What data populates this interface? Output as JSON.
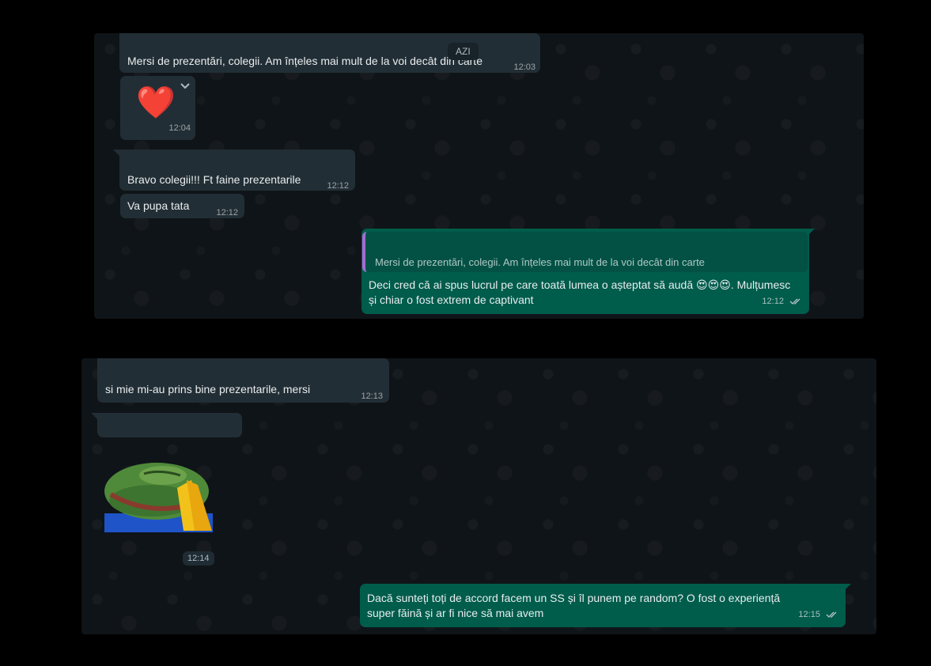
{
  "chat1": {
    "date_chip": "AZI",
    "messages": [
      {
        "text": "Mersi de prezentări, colegii. Am înțeles mai mult de la voi decât din carte",
        "time": "12:03"
      },
      {
        "emoji": "❤️",
        "time": "12:04"
      },
      {
        "text": "Bravo colegii!!! Ft faine prezentarile",
        "time": "12:12"
      },
      {
        "text": "Va pupa tata",
        "time": "12:12"
      }
    ],
    "reply": {
      "quoted": "Mersi de prezentări, colegii. Am înțeles mai mult de la voi decât din carte",
      "line1": "Deci cred că ai spus lucrul pe care toată lumea o așteptat să audă 😍😍😍. Mulțumesc",
      "line2": "și chiar o fost extrem de captivant",
      "time": "12:12"
    }
  },
  "chat2": {
    "messages": [
      {
        "text": "si mie mi-au prins bine prezentarile, mersi",
        "time": "12:13"
      },
      {
        "text": "",
        "time": ""
      },
      {
        "sticker": "pepe-praying-sticker",
        "time": "12:14"
      }
    ],
    "reply": {
      "line1": "Dacă sunteți toți de accord facem un SS și îl punem pe random? O fost o experiență",
      "line2": "super făină și ar fi nice să mai avem",
      "time": "12:15"
    }
  },
  "colors": {
    "incoming": "#222e35",
    "outgoing": "#005c4b",
    "quote_bar": "#a56bd4",
    "read_ticks": "#b9c6cc"
  }
}
